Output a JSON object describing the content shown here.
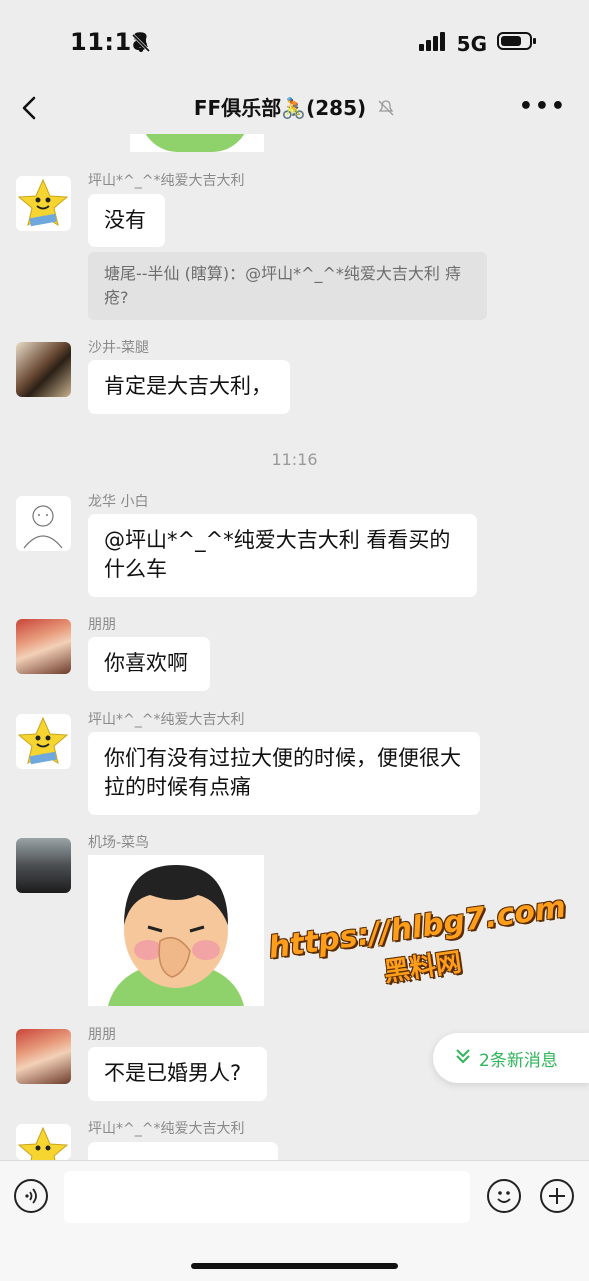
{
  "status": {
    "time": "11:18",
    "network": "5G"
  },
  "header": {
    "title": "FF俱乐部🚴(285)"
  },
  "messages": [
    {
      "name": "坪山*^_^*纯爱大吉大利",
      "text": "没有",
      "quote": "塘尾--半仙 (瞎算)：@坪山*^_^*纯爱大吉大利 痔疮?"
    },
    {
      "name": "沙井-菜腿",
      "text": "肯定是大吉大利，"
    },
    {
      "timestamp": "11:16"
    },
    {
      "name": "龙华 小白",
      "text": "@坪山*^_^*纯爱大吉大利 看看买的什么车"
    },
    {
      "name": "朋朋",
      "text": "你喜欢啊"
    },
    {
      "name": "坪山*^_^*纯爱大吉大利",
      "text": "你们有没有过拉大便的时候，便便很大拉的时候有点痛"
    },
    {
      "name": "机场-菜鸟",
      "image": "sticker-cartoon-face"
    },
    {
      "name": "朋朋",
      "text": "不是已婚男人?"
    },
    {
      "name": "坪山*^_^*纯爱大吉大利"
    }
  ],
  "watermark": {
    "url": "https://hlbg7.com",
    "site": "黑料网"
  },
  "new_messages_pill": {
    "label": "2条新消息",
    "icon": "double-chevron-down-icon",
    "color": "#2fb55a"
  },
  "input": {
    "placeholder": ""
  }
}
